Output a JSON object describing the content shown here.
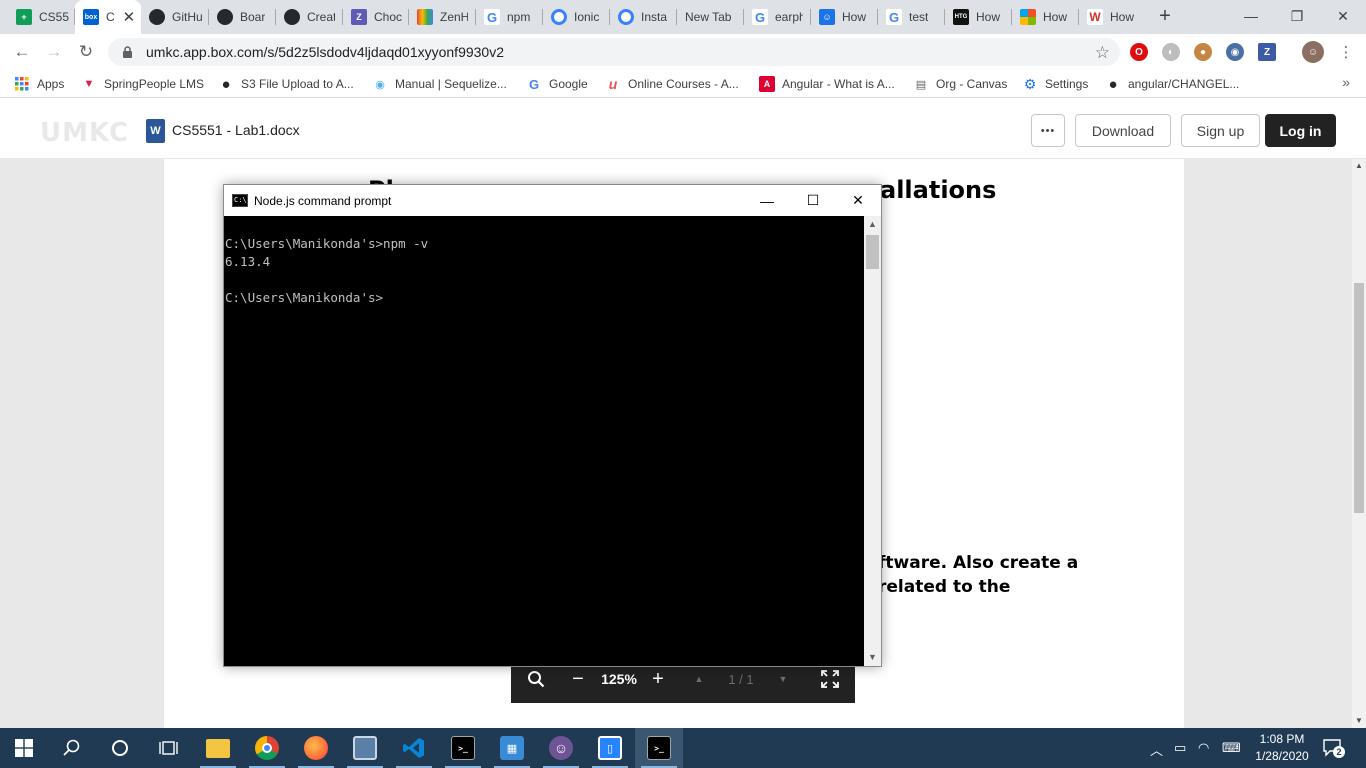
{
  "browser": {
    "tabs": [
      {
        "title": "CS55",
        "icon": "google-sheets-icon",
        "color": "#0f9d58",
        "glyph": "+"
      },
      {
        "title": "C",
        "icon": "box-icon",
        "color": "#0061d5",
        "glyph": "box",
        "active": true
      },
      {
        "title": "GitHu",
        "icon": "github-icon",
        "color": "#24292e",
        "glyph": ""
      },
      {
        "title": "Boar",
        "icon": "github-icon",
        "color": "#24292e",
        "glyph": ""
      },
      {
        "title": "Creat",
        "icon": "github-icon",
        "color": "#24292e",
        "glyph": ""
      },
      {
        "title": "Choc",
        "icon": "zenhub-icon",
        "color": "#5e5ab8",
        "glyph": "Z"
      },
      {
        "title": "ZenH",
        "icon": "zenhub-rainbow-icon",
        "color": "#f7b32b",
        "glyph": "^"
      },
      {
        "title": "npm",
        "icon": "google-icon",
        "color": "#4285f4",
        "glyph": "G"
      },
      {
        "title": "Ionic",
        "icon": "ionic-icon",
        "color": "#3880ff",
        "glyph": "o"
      },
      {
        "title": "Insta",
        "icon": "ionic-icon",
        "color": "#3880ff",
        "glyph": "o"
      },
      {
        "title": "New Tab",
        "icon": "",
        "color": "",
        "glyph": ""
      },
      {
        "title": "earph",
        "icon": "google-icon",
        "color": "#4285f4",
        "glyph": "G"
      },
      {
        "title": "How",
        "icon": "bot-icon",
        "color": "#1a73e8",
        "glyph": "U"
      },
      {
        "title": "test",
        "icon": "google-icon",
        "color": "#4285f4",
        "glyph": "G"
      },
      {
        "title": "How",
        "icon": "htg-icon",
        "color": "#111111",
        "glyph": "HTG"
      },
      {
        "title": "How",
        "icon": "microsoft-icon",
        "color": "#f25022",
        "glyph": "M"
      },
      {
        "title": "How",
        "icon": "wikihow-icon",
        "color": "#93b874",
        "glyph": "W"
      }
    ],
    "url": "umkc.app.box.com/s/5d2z5lsdodv4ljdaqd01xyyonf9930v2",
    "bookmarks": [
      {
        "label": "Apps",
        "icon": "apps-grid-icon",
        "color": "#4285f4",
        "glyph": "⋮⋮"
      },
      {
        "label": "SpringPeople LMS",
        "icon": "springpeople-icon",
        "color": "#e8174f",
        "glyph": "▼"
      },
      {
        "label": "S3 File Upload to A...",
        "icon": "github-icon",
        "color": "#24292e",
        "glyph": "●"
      },
      {
        "label": "Manual | Sequelize...",
        "icon": "sequelize-icon",
        "color": "#52b0e7",
        "glyph": "◉"
      },
      {
        "label": "Google",
        "icon": "google-icon",
        "color": "#4285f4",
        "glyph": "G"
      },
      {
        "label": "Online Courses - A...",
        "icon": "udemy-icon",
        "color": "#ec5252",
        "glyph": "u"
      },
      {
        "label": "Angular - What is A...",
        "icon": "angular-icon",
        "color": "#dd0031",
        "glyph": "A"
      },
      {
        "label": "Org - Canvas",
        "icon": "document-icon",
        "color": "#5f6368",
        "glyph": "▤"
      },
      {
        "label": "Settings",
        "icon": "gear-icon",
        "color": "#1a73e8",
        "glyph": "⚙"
      },
      {
        "label": "angular/CHANGEL...",
        "icon": "github-icon",
        "color": "#24292e",
        "glyph": "●"
      }
    ]
  },
  "box": {
    "logo_text": "UMKC",
    "document_name": "CS5551 - Lab1.docx",
    "more_label": "•••",
    "download_label": "Download",
    "signup_label": "Sign up",
    "login_label": "Log in"
  },
  "document": {
    "heading_visible": "Pl              l t  th  l  l          ft        I  t llations",
    "heading_tail": "allations",
    "para_line1": "ftware. Also create a",
    "para_line2": "related to the"
  },
  "viewer_toolbar": {
    "zoom_level": "125%",
    "page_indicator": "1 / 1"
  },
  "cmd_window": {
    "title": "Node.js command prompt",
    "icon_text": "C:\\",
    "lines": [
      "C:\\Users\\Manikonda's>npm -v",
      "6.13.4",
      "",
      "C:\\Users\\Manikonda's>"
    ]
  },
  "taskbar": {
    "clock_time": "1:08 PM",
    "clock_date": "1/28/2020",
    "notification_count": "2",
    "apps": [
      {
        "name": "file-explorer-icon",
        "color": "#f4c542",
        "glyph": "▭"
      },
      {
        "name": "chrome-icon",
        "color": "#db4437",
        "glyph": "◉"
      },
      {
        "name": "firefox-icon",
        "color": "#ff7139",
        "glyph": "●"
      },
      {
        "name": "remote-desktop-icon",
        "color": "#5b7fa6",
        "glyph": "▣"
      },
      {
        "name": "vscode-icon",
        "color": "#007acc",
        "glyph": "❮❯"
      },
      {
        "name": "command-prompt-icon",
        "color": "#000000",
        "glyph": ">_"
      },
      {
        "name": "control-panel-icon",
        "color": "#3a8bd6",
        "glyph": "▦"
      },
      {
        "name": "github-desktop-icon",
        "color": "#6e5494",
        "glyph": "☺"
      },
      {
        "name": "sourcetree-icon",
        "color": "#2684ff",
        "glyph": "▯"
      },
      {
        "name": "nodejs-prompt-icon",
        "color": "#000000",
        "glyph": ">_"
      }
    ]
  }
}
